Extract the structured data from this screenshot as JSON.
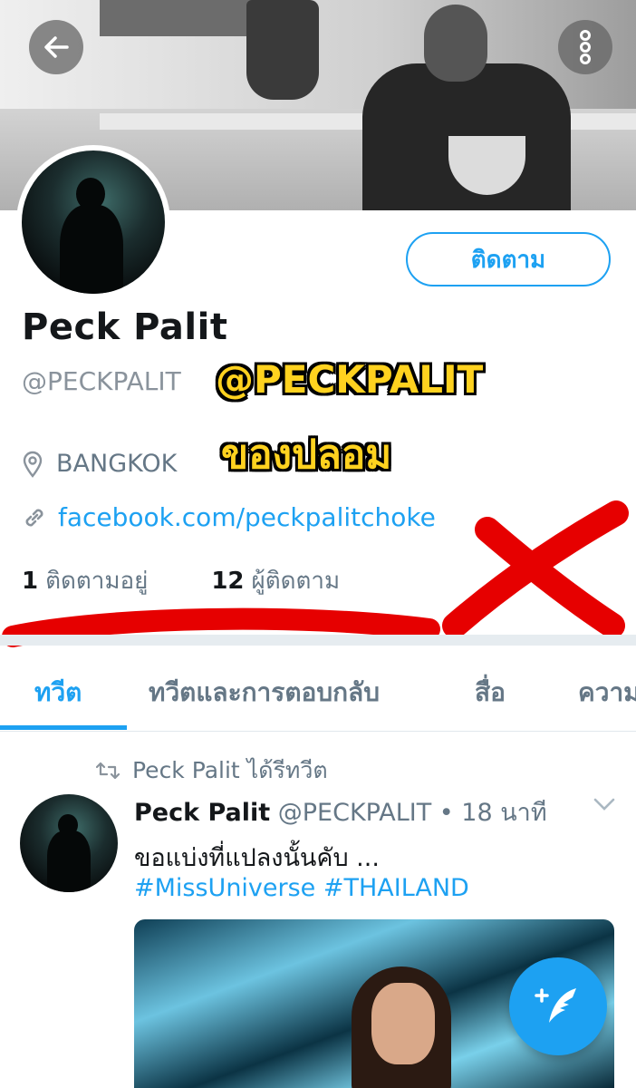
{
  "header": {
    "back_icon": "arrow-left-icon",
    "menu_icon": "more-vertical-icon"
  },
  "profile": {
    "follow_label": "ติดตาม",
    "name": "Peck Palit",
    "handle": "@PECKPALIT",
    "location": "BANGKOK",
    "link": "facebook.com/peckpalitchoke",
    "following_count": "1",
    "following_label": "ติดตามอยู่",
    "followers_count": "12",
    "followers_label": "ผู้ติดตาม"
  },
  "annotation": {
    "line1": "@PECKPALIT",
    "line2": "ของปลอม",
    "color": "#ffd21f",
    "mark_color": "#e60000"
  },
  "tabs": [
    {
      "label": "ทวีต",
      "active": true
    },
    {
      "label": "ทวีตและการตอบกลับ",
      "active": false
    },
    {
      "label": "สื่อ",
      "active": false
    },
    {
      "label": "ความ",
      "active": false
    }
  ],
  "tweet": {
    "retweet_text": "Peck Palit ได้รีทวีต",
    "author": "Peck Palit",
    "meta": "@PECKPALIT • 18 นาที",
    "text": "ขอแบ่งที่แปลงนั้นคับ ...",
    "hashtags": "#MissUniverse #THAILAND"
  },
  "colors": {
    "accent": "#1da1f2",
    "secondary_text": "#657786"
  }
}
